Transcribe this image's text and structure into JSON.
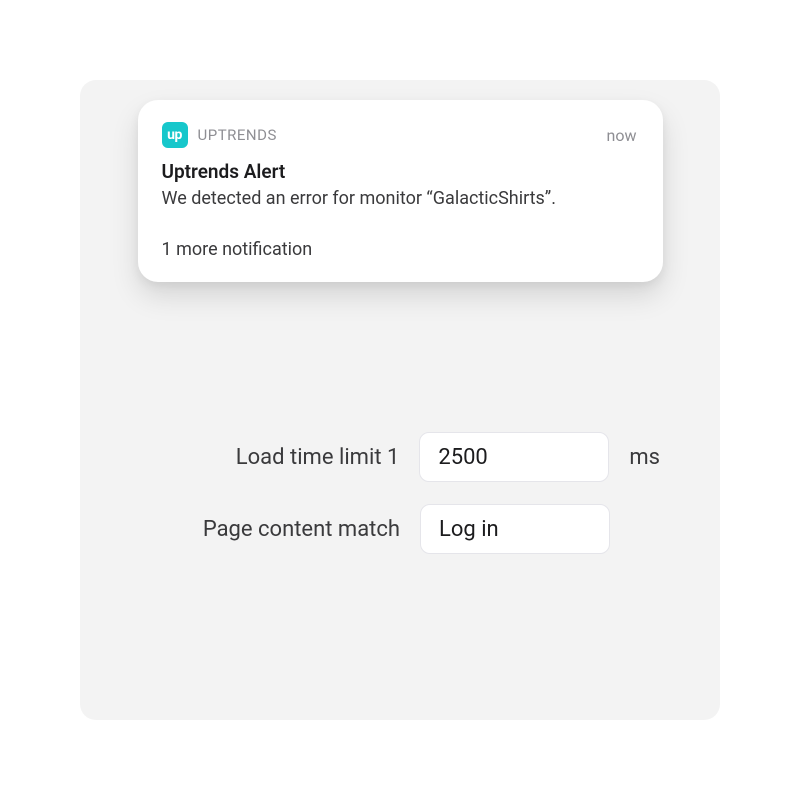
{
  "notification": {
    "logo_text": "up",
    "app_name": "UPTRENDS",
    "timestamp": "now",
    "title": "Uptrends Alert",
    "body": "We detected an error for monitor “GalacticShirts”.",
    "more": "1 more notification"
  },
  "settings": {
    "load_time": {
      "label": "Load time limit 1",
      "value": "2500",
      "unit": "ms"
    },
    "content_match": {
      "label": "Page content match",
      "value": "Log in"
    }
  }
}
